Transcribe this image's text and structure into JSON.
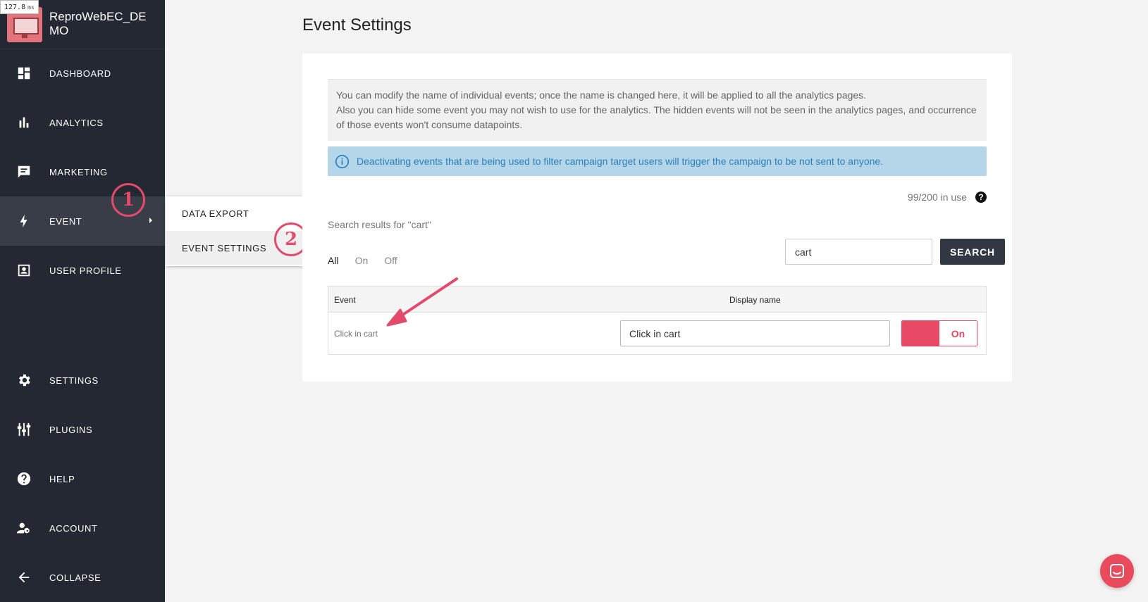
{
  "perf": {
    "value": "127.8",
    "unit": "ms"
  },
  "app": {
    "name": "ReproWebEC_DEMO"
  },
  "sidebar": {
    "items": [
      {
        "label": "DASHBOARD",
        "icon": "dashboard-icon"
      },
      {
        "label": "ANALYTICS",
        "icon": "bar-chart-icon"
      },
      {
        "label": "MARKETING",
        "icon": "message-icon"
      },
      {
        "label": "EVENT",
        "icon": "lightning-icon"
      },
      {
        "label": "USER PROFILE",
        "icon": "user-profile-icon"
      },
      {
        "label": "SETTINGS",
        "icon": "gear-icon"
      },
      {
        "label": "PLUGINS",
        "icon": "plugins-icon"
      },
      {
        "label": "HELP",
        "icon": "help-icon"
      },
      {
        "label": "ACCOUNT",
        "icon": "account-settings-icon"
      },
      {
        "label": "COLLAPSE",
        "icon": "arrow-left-icon"
      }
    ]
  },
  "flyout": {
    "items": [
      {
        "label": "DATA EXPORT"
      },
      {
        "label": "EVENT SETTINGS"
      }
    ]
  },
  "annotations": {
    "step1": "1",
    "step2": "2"
  },
  "page": {
    "title": "Event Settings"
  },
  "description": {
    "line1": "You can modify the name of individual events; once the name is changed here, it will be applied to all the analytics pages.",
    "line2": "Also you can hide some event you may not wish to use for the analytics. The hidden events will not be seen in the analytics pages, and occurrence of those events won't consume datapoints."
  },
  "alert": {
    "text": "Deactivating events that are being used to filter campaign target users will trigger the campaign to be not sent to anyone."
  },
  "usage": {
    "text": "99/200 in use"
  },
  "search": {
    "results_label": "Search results for \"cart\"",
    "value": "cart",
    "button": "SEARCH"
  },
  "filters": {
    "all": "All",
    "on": "On",
    "off": "Off"
  },
  "table": {
    "headers": {
      "event": "Event",
      "display": "Display name"
    },
    "rows": [
      {
        "event": "Click in cart",
        "display_name": "Click in cart",
        "status": "On"
      }
    ]
  },
  "colors": {
    "sidebar": "#232833",
    "accent": "#e84a66",
    "alert_bg": "#b5d6e8",
    "alert_text": "#2a80bf"
  }
}
